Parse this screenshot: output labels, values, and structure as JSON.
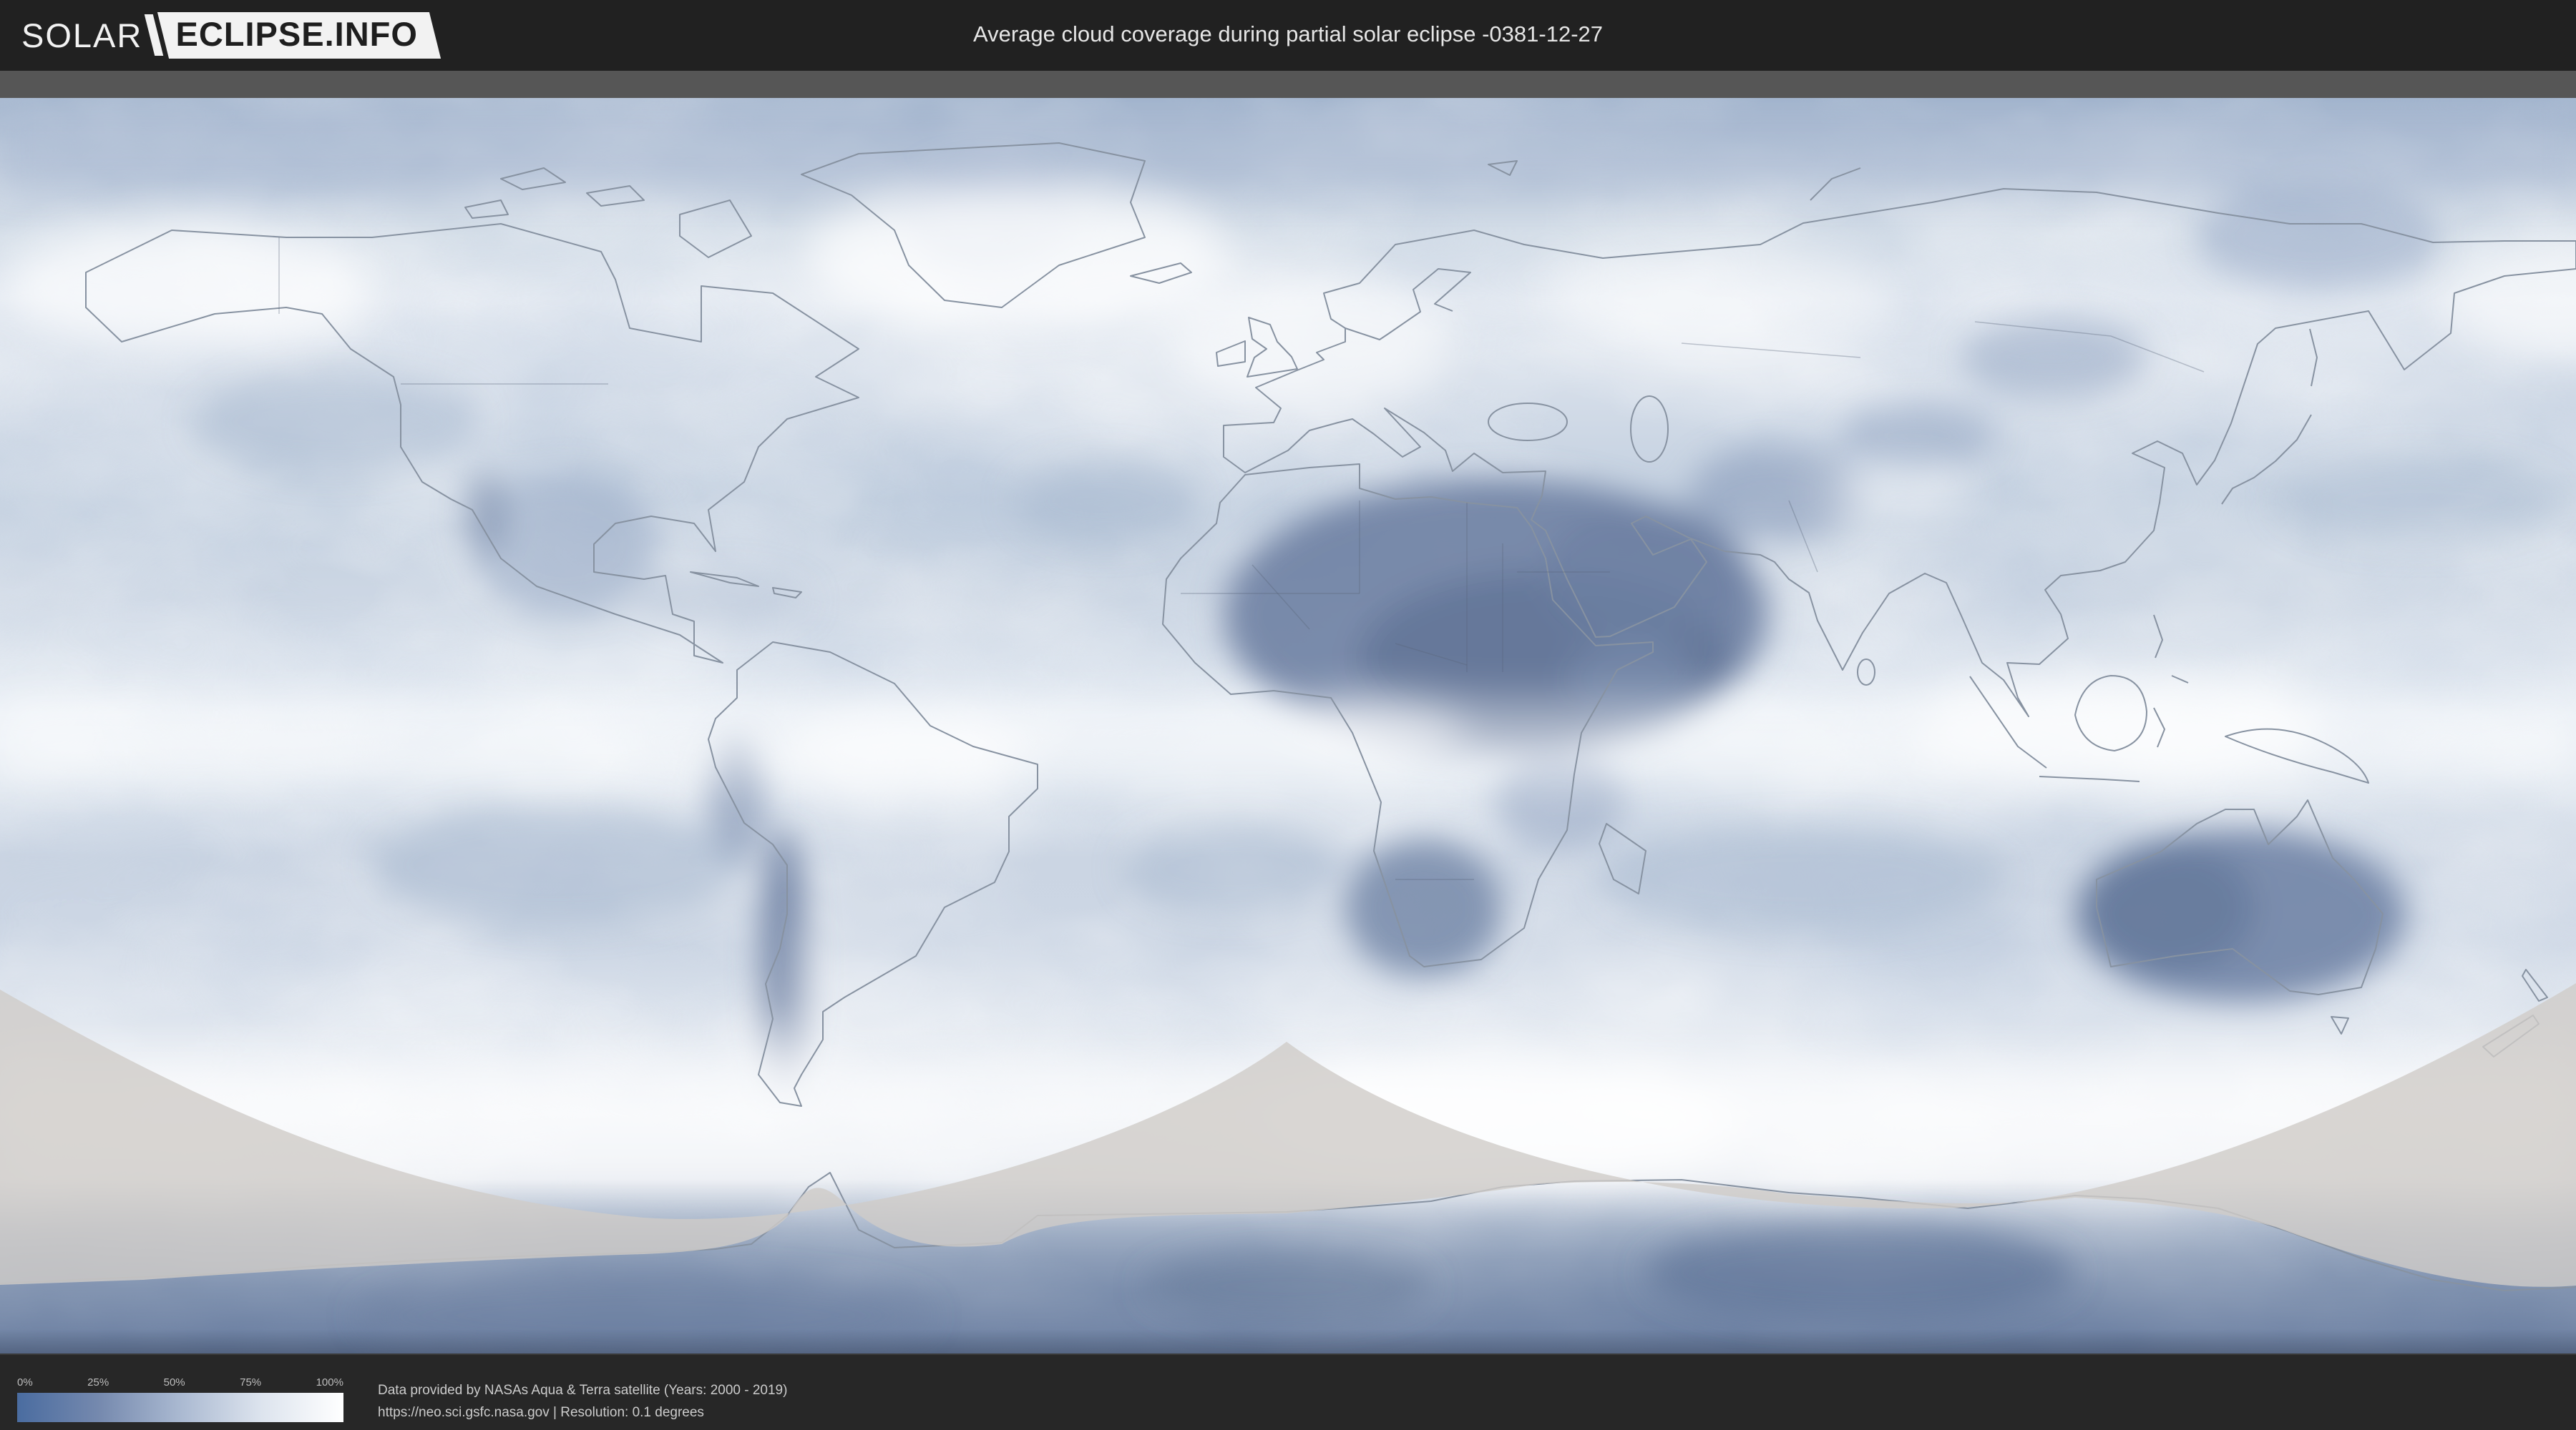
{
  "header": {
    "logo": {
      "part1": "SOLAR",
      "part2": "ECLIPSE.INFO"
    },
    "title": "Average cloud coverage during partial solar eclipse -0381-12-27"
  },
  "legend": {
    "ticks": [
      "0%",
      "25%",
      "50%",
      "75%",
      "100%"
    ],
    "gradient_start": "#4a6ca0",
    "gradient_end": "#ffffff"
  },
  "footer": {
    "line1": "Data provided by NASAs Aqua & Terra satellite (Years: 2000 - 2019)",
    "line2": "https://neo.sci.gsfc.nasa.gov | Resolution: 0.1 degrees"
  },
  "map": {
    "colors": {
      "clear_sky_low_cloud": "#66799e",
      "high_cloud": "#ffffff",
      "ocean_band": "#a2b3cc",
      "eclipse_not_visible_overlay": "#cfccc8",
      "coastline": "#8792a1",
      "antarctic_band": "#5f7499"
    }
  }
}
